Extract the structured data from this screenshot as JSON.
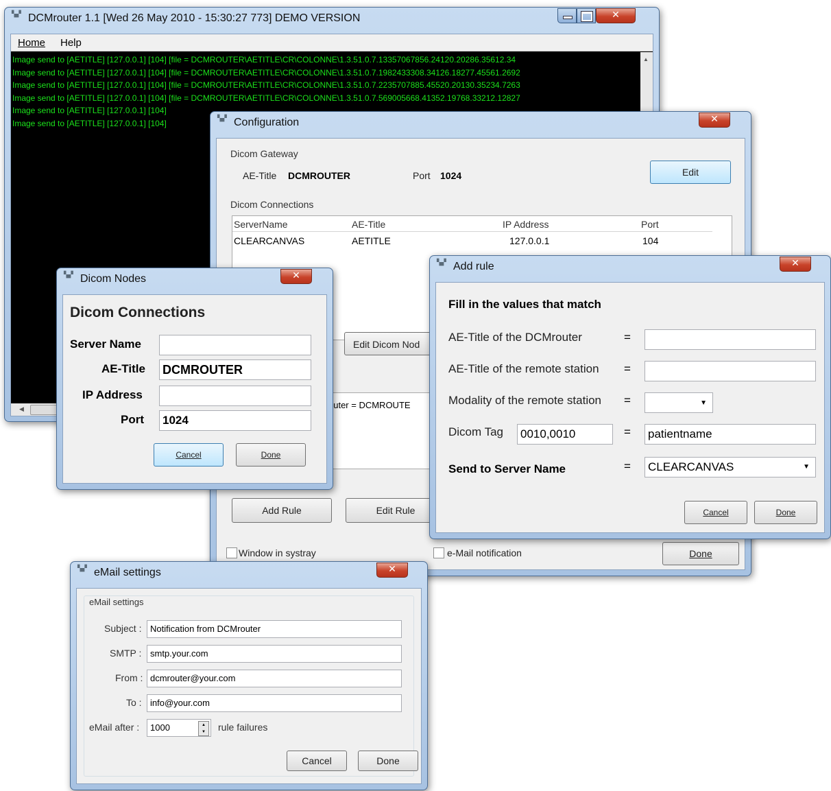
{
  "main_window": {
    "title": "DCMrouter 1.1 [Wed 26 May 2010 - 15:30:27 773] DEMO VERSION",
    "menu": [
      {
        "label": "Home"
      },
      {
        "label": "Help"
      }
    ],
    "log_lines": [
      "Image send to [AETITLE] [127.0.0.1] [104] [file = DCMROUTER\\AETITLE\\CR\\COLONNE\\1.3.51.0.7.13357067856.24120.20286.35612.34",
      "Image send to [AETITLE] [127.0.0.1] [104] [file = DCMROUTER\\AETITLE\\CR\\COLONNE\\1.3.51.0.7.1982433308.34126.18277.45561.2692",
      "Image send to [AETITLE] [127.0.0.1] [104] [file = DCMROUTER\\AETITLE\\CR\\COLONNE\\1.3.51.0.7.2235707885.45520.20130.35234.7263",
      "Image send to [AETITLE] [127.0.0.1] [104] [file = DCMROUTER\\AETITLE\\CR\\COLONNE\\1.3.51.0.7.569005668.41352.19768.33212.12827",
      "Image send to [AETITLE] [127.0.0.1] [104]",
      "Image send to [AETITLE] [127.0.0.1] [104]"
    ]
  },
  "config": {
    "title": "Configuration",
    "gateway_label": "Dicom Gateway",
    "ae_label": "AE-Title",
    "ae_value": "DCMROUTER",
    "port_label": "Port",
    "port_value": "1024",
    "edit_button": "Edit",
    "connections_label": "Dicom Connections",
    "columns": [
      "ServerName",
      "AE-Title",
      "IP Address",
      "Port"
    ],
    "rows": [
      [
        "CLEARCANVAS",
        "AETITLE",
        "127.0.0.1",
        "104"
      ]
    ],
    "edit_nodes_button": "Edit Dicom Nod",
    "rule_text": "outer = DCMROUTE",
    "add_rule_button": "Add Rule",
    "edit_rule_button": "Edit Rule",
    "systray_label": "Window in systray",
    "email_label": "e-Mail notification",
    "done_button": "Done"
  },
  "nodes": {
    "title": "Dicom Nodes",
    "heading": "Dicom Connections",
    "server_label": "Server Name",
    "server_value": "",
    "ae_label": "AE-Title",
    "ae_value": "DCMROUTER",
    "ip_label": "IP Address",
    "ip_value": "",
    "port_label": "Port",
    "port_value": "1024",
    "cancel": "Cancel",
    "done": "Done"
  },
  "addrule": {
    "title": "Add rule",
    "heading": "Fill in the values that match",
    "row1_label": "AE-Title of the DCMrouter",
    "row2_label": "AE-Title of the remote station",
    "row3_label": "Modality of the remote station",
    "tag_label": "Dicom Tag",
    "tag_value": "0010,0010",
    "tag_match": "patientname",
    "send_label": "Send to Server Name",
    "send_value": "CLEARCANVAS",
    "eq": "=",
    "cancel": "Cancel",
    "done": "Done"
  },
  "email": {
    "title": "eMail settings",
    "group": "eMail settings",
    "subject_label": "Subject :",
    "subject_value": "Notification from DCMrouter",
    "smtp_label": "SMTP :",
    "smtp_value": "smtp.your.com",
    "from_label": "From :",
    "from_value": "dcmrouter@your.com",
    "to_label": "To :",
    "to_value": "info@your.com",
    "after_label": "eMail after :",
    "after_value": "1000",
    "failures_label": "rule failures",
    "cancel": "Cancel",
    "done": "Done"
  },
  "icons": {
    "close": "✕",
    "restore": "□",
    "minimize": "—",
    "scroll_up": "▲",
    "scroll_left": "◀",
    "dropdown": "▼",
    "spin_up": "▲",
    "spin_down": "▼"
  }
}
